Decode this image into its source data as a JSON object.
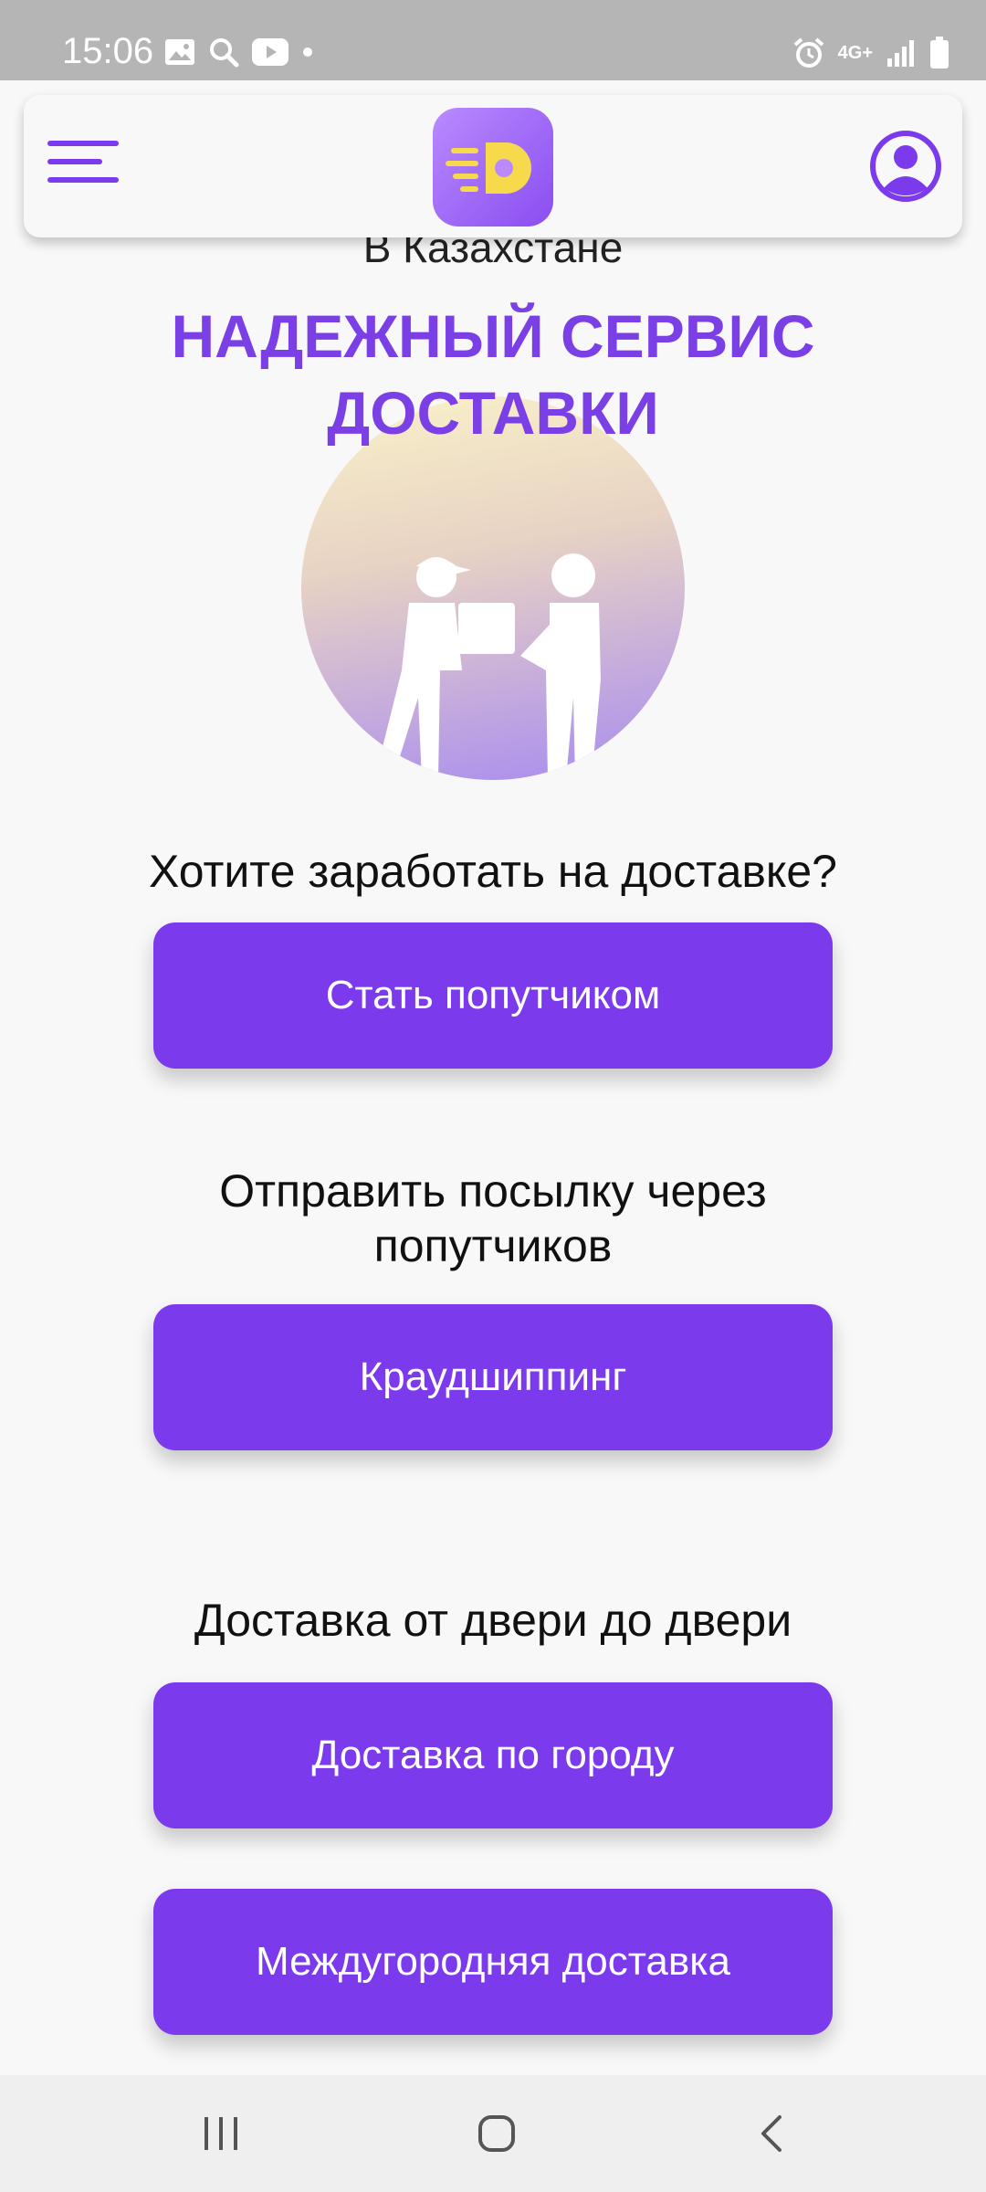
{
  "status_bar": {
    "time": "15:06",
    "network": "4G+",
    "left_icons": [
      "image-icon",
      "search-icon",
      "youtube-icon",
      "dot-icon"
    ],
    "right_icons": [
      "alarm-icon",
      "network-icon",
      "signal-icon",
      "battery-icon"
    ]
  },
  "header": {
    "menu_icon": "menu-icon",
    "logo": "app-logo",
    "profile_icon": "user-avatar-icon"
  },
  "hero": {
    "subtitle_partial": "В Казахстане",
    "title_line1": "НАДЕЖНЫЙ СЕРВИС",
    "title_line2": "ДОСТАВКИ",
    "illustration": "delivery-handoff-illustration"
  },
  "sections": {
    "earn": {
      "heading": "Хотите заработать на доставке?",
      "button": "Стать попутчиком"
    },
    "send": {
      "heading_line1": "Отправить посылку через",
      "heading_line2": "попутчиков",
      "button": "Краудшиппинг"
    },
    "door": {
      "heading": "Доставка от двери до двери",
      "button_city": "Доставка по городу",
      "button_intercity": "Междугородняя доставка"
    }
  },
  "colors": {
    "accent": "#7c3aed",
    "title": "#7b3fe6",
    "status_bar": "#b5b5b5",
    "background": "#f8f8f8"
  },
  "nav_bar": {
    "icons": [
      "recents-icon",
      "home-icon",
      "back-icon"
    ]
  }
}
